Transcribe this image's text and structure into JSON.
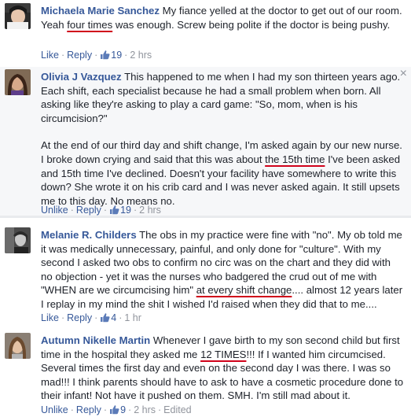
{
  "comments": [
    {
      "name": "Michaela Marie Sanchez",
      "text_before": "My fiance yelled at the doctor to get out of our room. Yeah ",
      "highlight": "four times",
      "text_after": " was enough. Screw being polite if the doctor is being pushy.",
      "action1": "Like",
      "action2": "Reply",
      "likes": "19",
      "time": "2 hrs",
      "extra": ""
    },
    {
      "name": "Olivia J Vazquez",
      "text_before": "This happened to me when I had my son thirteen years ago. Each shift, each specialist because he had a small problem when born. All asking like they're asking to play a card game: \"So, mom, when is his circumcision?\"",
      "p2_before": "At the end of our third day and shift change, I'm asked again by our new nurse. I broke down crying and said that this was about ",
      "highlight": "the 15th time",
      "text_after": " I've been asked and 15th time I've declined. Doesn't your facility have somewhere to write this down? She wrote it on his crib card and I was never asked again. It still upsets me to this day. No means no.",
      "action1": "Unlike",
      "action2": "Reply",
      "likes": "19",
      "time": "2 hrs",
      "extra": "",
      "close": "×"
    },
    {
      "name": "Melanie R. Childers",
      "text_before": "The obs in my practice were fine with \"no\". My ob told me it was medically unnecessary, painful, and only done for \"culture\". With my second I asked two obs to confirm no circ was on the chart and they did with no objection - yet it was the nurses who badgered the crud out of me with \"WHEN are we circumcising him\" ",
      "highlight": "at every shift change",
      "text_after": ".... almost 12 years later I replay in my mind the shit I wished I'd raised when they did that to me....",
      "action1": "Like",
      "action2": "Reply",
      "likes": "4",
      "time": "1 hr",
      "extra": ""
    },
    {
      "name": "Autumn Nikelle Martin",
      "text_before": "Whenever I gave birth to my son second child but first time in the hospital they asked me ",
      "highlight": "12 TIMES",
      "text_after": "!!! If I wanted him circumcised. Several times the first day and even on the second day I was there. I was so mad!!! I think parents should have to ask to have a cosmetic procedure done to their infant! Not have it pushed on them. SMH. I'm still mad about it.",
      "action1": "Unlike",
      "action2": "Reply",
      "likes": "9",
      "time": "2 hrs",
      "extra": "Edited"
    }
  ],
  "separator": "·",
  "colors": {
    "link": "#365899",
    "meta": "#90949c",
    "highlight_underline": "#d0021b",
    "text": "#1d2129"
  },
  "icons": [
    "thumbs-up-icon",
    "close-icon"
  ]
}
